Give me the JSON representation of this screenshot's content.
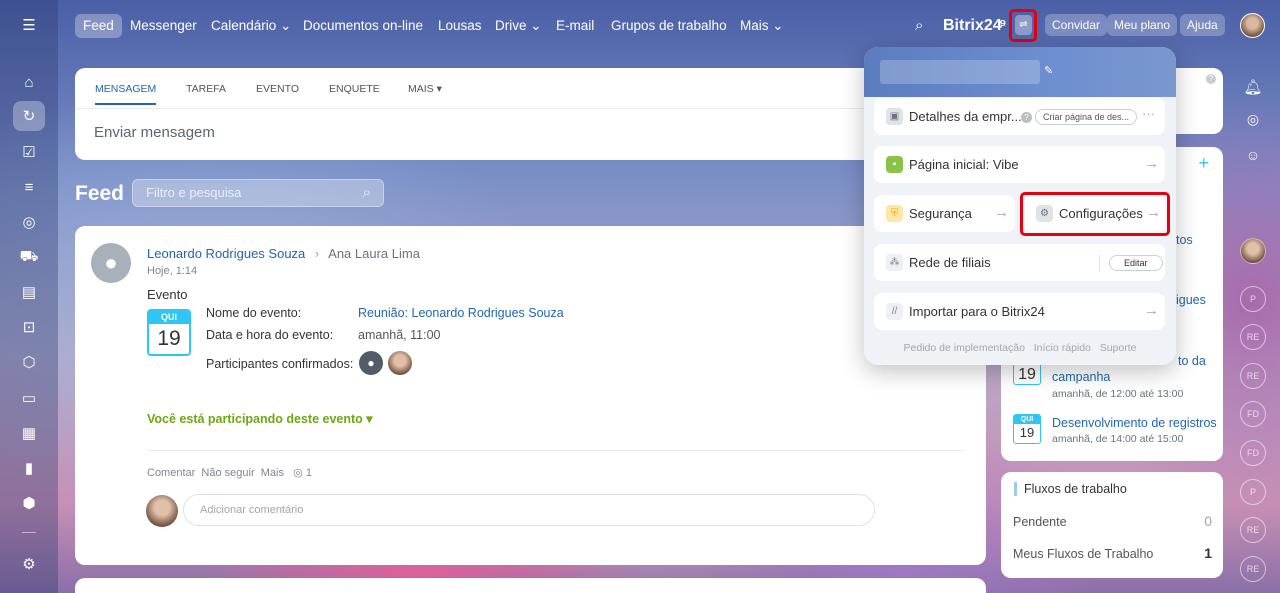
{
  "topnav": {
    "items": [
      "Feed",
      "Messenger",
      "Calendário",
      "Documentos on-line",
      "Lousas",
      "Drive",
      "E-mail",
      "Grupos de trabalho",
      "Mais"
    ],
    "brand": "Bitrix24",
    "invite": "Convidar",
    "plan": "Meu plano",
    "help": "Ajuda"
  },
  "composer": {
    "tabs": [
      "MENSAGEM",
      "TAREFA",
      "EVENTO",
      "ENQUETE",
      "MAIS"
    ],
    "placeholder": "Enviar mensagem"
  },
  "feed": {
    "title": "Feed",
    "filter_placeholder": "Filtro e pesquisa"
  },
  "post": {
    "author": "Leonardo Rodrigues Souza",
    "recipient": "Ana Laura Lima",
    "time": "Hoje, 1:14",
    "type": "Evento",
    "cal_day_name": "QUI",
    "cal_day": "19",
    "fields": [
      {
        "label": "Nome do evento:",
        "value": "Reunião: Leonardo Rodrigues Souza"
      },
      {
        "label": "Data e hora do evento:",
        "value": "amanhã, 11:00"
      },
      {
        "label": "Participantes confirmados:",
        "value": ""
      }
    ],
    "participating": "Você está participando deste evento",
    "actions": {
      "comment": "Comentar",
      "unfollow": "Não seguir",
      "more": "Mais",
      "views": "1"
    },
    "comment_placeholder": "Adicionar comentário"
  },
  "menu": {
    "details": "Detalhes da empr...",
    "create_page": "Criar página de des...",
    "home": "Página inicial: Vibe",
    "security": "Segurança",
    "settings": "Configurações",
    "network": "Rede de filiais",
    "edit": "Editar",
    "import": "Importar para o Bitrix24",
    "footer": [
      "Pedido de implementação",
      "Início rápido",
      "Suporte"
    ]
  },
  "right": {
    "partial1": "tos",
    "partial2": "igues",
    "event1_title_a": "to da",
    "event1_title_b": "campanha",
    "event1_time": "amanhã, de 12:00 até 13:00",
    "event2_title": "Desenvolvimento de registros",
    "event2_time": "amanhã, de 14:00 até 15:00",
    "cal_day_name": "QUI",
    "cal_day": "19",
    "workflows": {
      "title": "Fluxos de trabalho",
      "rows": [
        {
          "label": "Pendente",
          "count": "0"
        },
        {
          "label": "Meus Fluxos de Trabalho",
          "count": "1"
        }
      ]
    }
  },
  "rail": {
    "badges": [
      "P",
      "RE",
      "RE",
      "FD",
      "P",
      "RE",
      "RE"
    ]
  }
}
